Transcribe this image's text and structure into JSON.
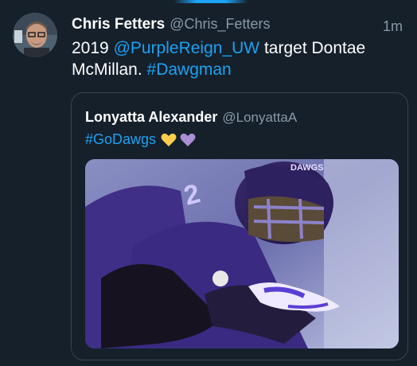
{
  "tweet": {
    "author": {
      "display_name": "Chris Fetters",
      "handle": "@Chris_Fetters",
      "avatar_icon": "avatar-photo"
    },
    "timestamp": "1m",
    "text": {
      "line1_prefix": "2019 ",
      "mention": "@PurpleReign_UW",
      "line1_suffix": " target Dontae",
      "line2_prefix": "McMillan. ",
      "hashtag": "#Dawgman"
    }
  },
  "quoted_tweet": {
    "author": {
      "display_name": "Lonyatta Alexander",
      "handle": "@LonyattaA"
    },
    "hashtag": "#GoDawgs",
    "emoji": [
      "yellow-heart-icon",
      "purple-heart-icon"
    ],
    "media": {
      "icon": "football-player-photo",
      "helmet_text": "DAWGS",
      "jersey_number": "2"
    }
  },
  "colors": {
    "background": "#15202b",
    "accent": "#1da1f2",
    "muted": "#8899a6",
    "border": "#38444d"
  }
}
